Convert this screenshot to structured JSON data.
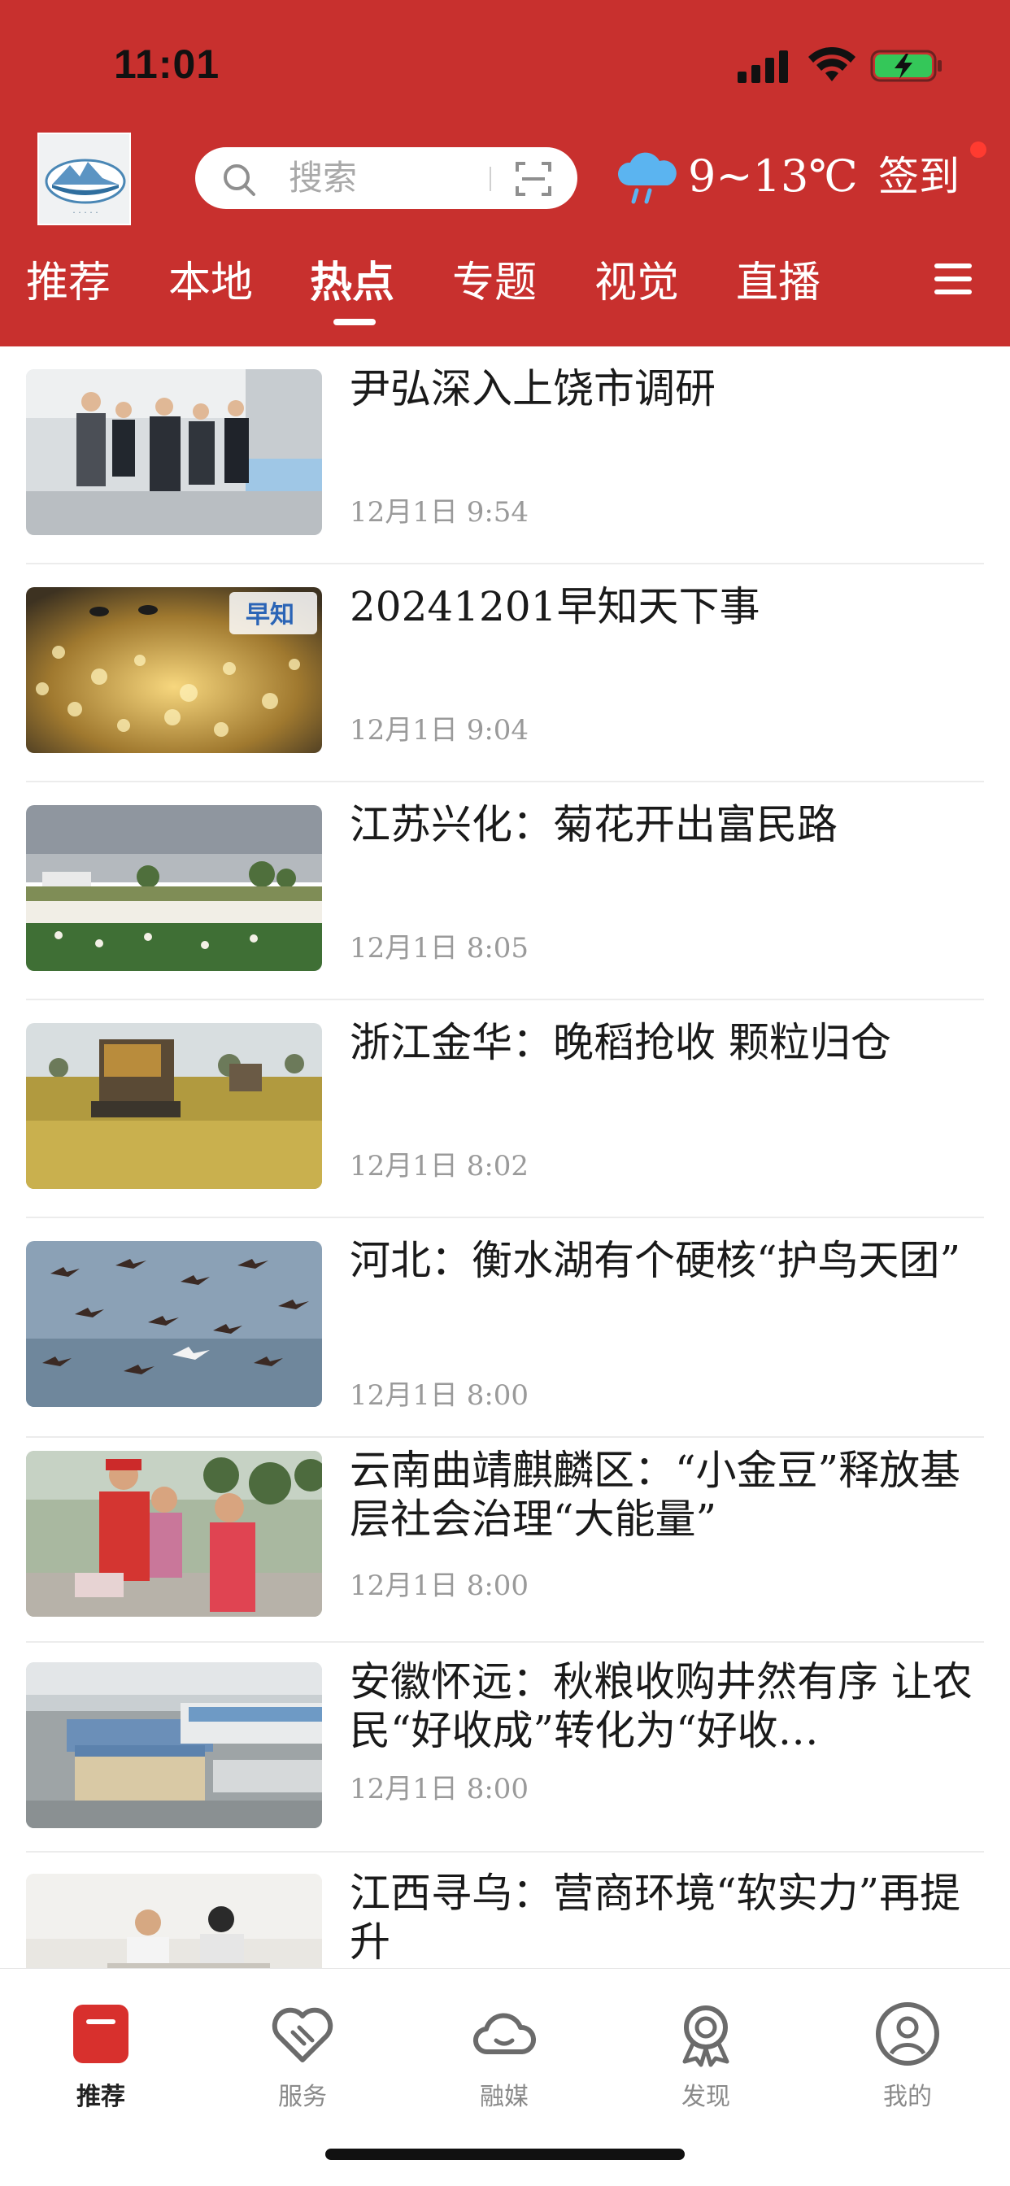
{
  "status_bar": {
    "time": "11:01"
  },
  "header": {
    "search_placeholder": "搜索",
    "weather": "9~13℃",
    "signin_label": "签到",
    "colors": {
      "brand_red": "#c8302e",
      "badge_dot": "#ff3b30"
    }
  },
  "tabs": [
    {
      "label": "推荐",
      "active": false
    },
    {
      "label": "本地",
      "active": false
    },
    {
      "label": "热点",
      "active": true
    },
    {
      "label": "专题",
      "active": false
    },
    {
      "label": "视觉",
      "active": false
    },
    {
      "label": "直播",
      "active": false
    }
  ],
  "news": [
    {
      "title": "尹弘深入上饶市调研",
      "date": "12月1日  9:54",
      "thumb": "officials-visit-photo"
    },
    {
      "title": "20241201早知天下事",
      "date": "12月1日  9:04",
      "thumb": "sparkling-water-birds-photo"
    },
    {
      "title": "江苏兴化：菊花开出富民路",
      "date": "12月1日  8:05",
      "thumb": "chrysanthemum-field-photo"
    },
    {
      "title": "浙江金华：晚稻抢收  颗粒归仓",
      "date": "12月1日  8:02",
      "thumb": "rice-harvester-photo"
    },
    {
      "title": "河北：衡水湖有个硬核“护鸟天团”",
      "date": "12月1日  8:00",
      "thumb": "flying-birds-lake-photo"
    },
    {
      "title": "云南曲靖麒麟区：“小金豆”释放基层社会治理“大能量”",
      "date": "12月1日  8:00",
      "thumb": "volunteers-photo"
    },
    {
      "title": "安徽怀远：秋粮收购井然有序  让农民“好收成”转化为“好收…",
      "date": "12月1日  8:00",
      "thumb": "grain-depot-aerial-photo"
    },
    {
      "title": "江西寻乌：营商环境“软实力”再提升",
      "date": "",
      "thumb": "office-workers-photo"
    }
  ],
  "tabbar": [
    {
      "label": "推荐",
      "icon": "news-icon",
      "active": true
    },
    {
      "label": "服务",
      "icon": "handshake-heart-icon",
      "active": false
    },
    {
      "label": "融媒",
      "icon": "cloud-icon",
      "active": false
    },
    {
      "label": "发现",
      "icon": "award-badge-icon",
      "active": false
    },
    {
      "label": "我的",
      "icon": "user-profile-icon",
      "active": false
    }
  ]
}
